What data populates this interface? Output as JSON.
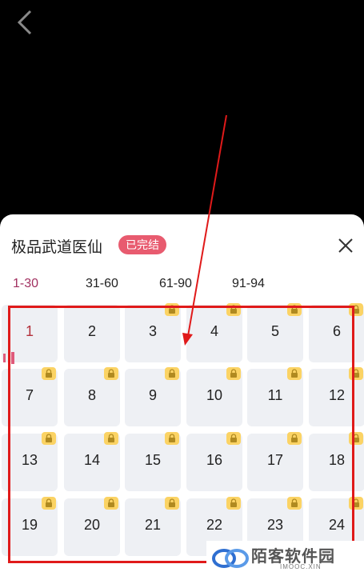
{
  "book_title": "极品武道医仙",
  "status_badge": "已完结",
  "tabs": [
    {
      "label": "1-30",
      "active": true
    },
    {
      "label": "31-60",
      "active": false
    },
    {
      "label": "61-90",
      "active": false
    },
    {
      "label": "91-94",
      "active": false
    }
  ],
  "chapters": [
    {
      "n": "1",
      "locked": false,
      "current": true
    },
    {
      "n": "2",
      "locked": false
    },
    {
      "n": "3",
      "locked": true
    },
    {
      "n": "4",
      "locked": true
    },
    {
      "n": "5",
      "locked": true
    },
    {
      "n": "6",
      "locked": true
    },
    {
      "n": "7",
      "locked": true
    },
    {
      "n": "8",
      "locked": true
    },
    {
      "n": "9",
      "locked": true
    },
    {
      "n": "10",
      "locked": true
    },
    {
      "n": "11",
      "locked": true
    },
    {
      "n": "12",
      "locked": true
    },
    {
      "n": "13",
      "locked": true
    },
    {
      "n": "14",
      "locked": true
    },
    {
      "n": "15",
      "locked": true
    },
    {
      "n": "16",
      "locked": true
    },
    {
      "n": "17",
      "locked": true
    },
    {
      "n": "18",
      "locked": true
    },
    {
      "n": "19",
      "locked": true
    },
    {
      "n": "20",
      "locked": true
    },
    {
      "n": "21",
      "locked": true
    },
    {
      "n": "22",
      "locked": true
    },
    {
      "n": "23",
      "locked": true
    },
    {
      "n": "24",
      "locked": true
    }
  ],
  "watermark": {
    "name": "陌客软件园",
    "url": "IMOOC.XIN"
  },
  "colors": {
    "active_tab": "#a13060",
    "badge": "#e85b6f",
    "lock": "#fbd364",
    "annotation": "#e01a1a"
  },
  "icons": {
    "back": "chevron-left-icon",
    "close": "close-icon",
    "lock": "lock-icon"
  }
}
